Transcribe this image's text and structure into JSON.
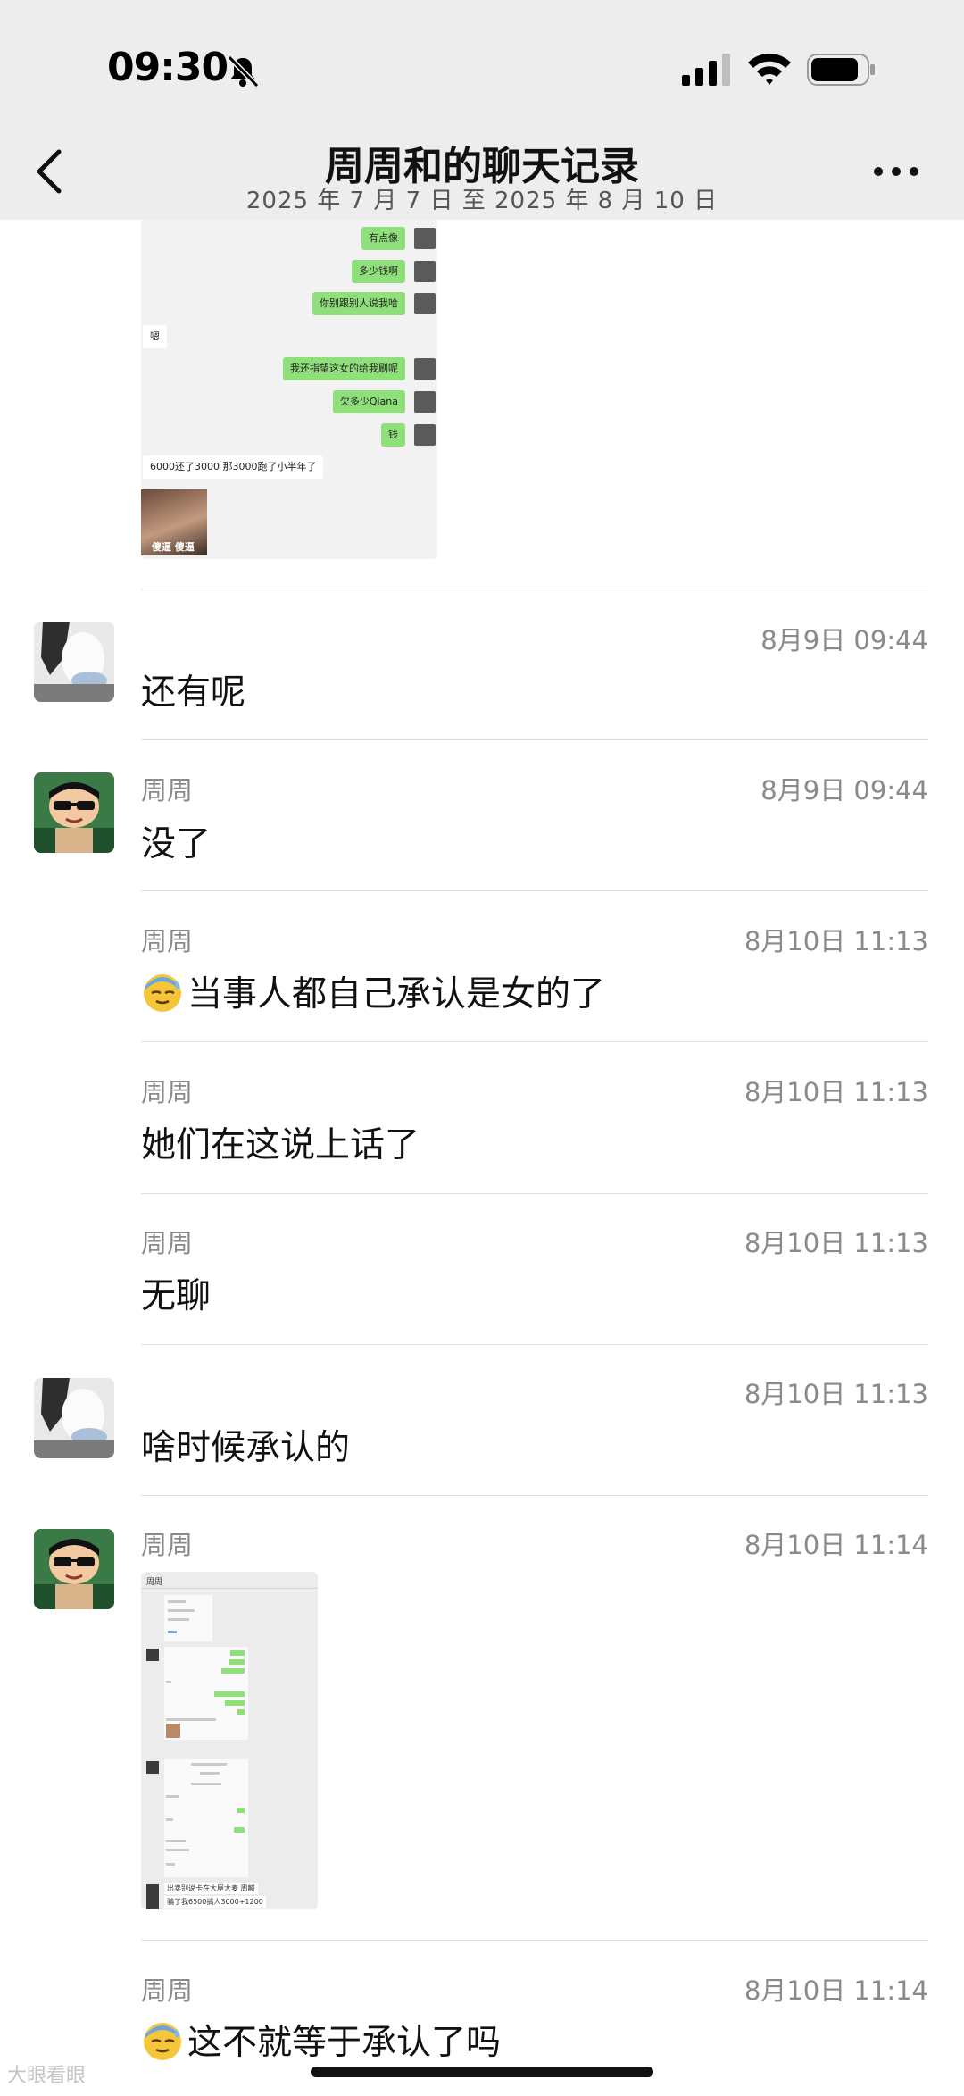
{
  "status_bar": {
    "time": "09:30"
  },
  "header": {
    "title": "周周和的聊天记录",
    "subtitle": "2025 年 7 月 7 日 至 2025 年 8 月 10 日"
  },
  "first_card": {
    "messages": [
      {
        "text": "有点像",
        "side": "right"
      },
      {
        "text": "多少钱啊",
        "side": "right"
      },
      {
        "text": "你别跟别人说我哈",
        "side": "right"
      },
      {
        "text": "嗯",
        "side": "left"
      },
      {
        "text": "我还指望这女的给我刷呢",
        "side": "right"
      },
      {
        "text": "欠多少Qiana",
        "side": "right"
      },
      {
        "text": "钱",
        "side": "right"
      },
      {
        "text": "6000还了3000 那3000跑了小半年了",
        "side": "left"
      }
    ],
    "sticker_caption": "傻逼 傻逼"
  },
  "rows": [
    {
      "name": "",
      "time": "8月9日 09:44",
      "text": "还有呢"
    },
    {
      "name": "周周",
      "time": "8月9日 09:44",
      "text": "没了"
    },
    {
      "name": "周周",
      "time": "8月10日 11:13",
      "text": "当事人都自己承认是女的了"
    },
    {
      "name": "周周",
      "time": "8月10日 11:13",
      "text": "她们在这说上话了"
    },
    {
      "name": "周周",
      "time": "8月10日 11:13",
      "text": "无聊"
    },
    {
      "name": "",
      "time": "8月10日 11:13",
      "text": "啥时候承认的"
    },
    {
      "name": "周周",
      "time": "8月10日 11:14",
      "text": ""
    },
    {
      "name": "周周",
      "time": "8月10日 11:14",
      "text": "这不就等于承认了吗"
    }
  ],
  "second_card": {
    "title": "周周",
    "line1": "出卖别说卡在大屋大麦 周麟",
    "line2": "骗了我6500搞人3000+1200"
  },
  "watermark": "大眼看眼"
}
